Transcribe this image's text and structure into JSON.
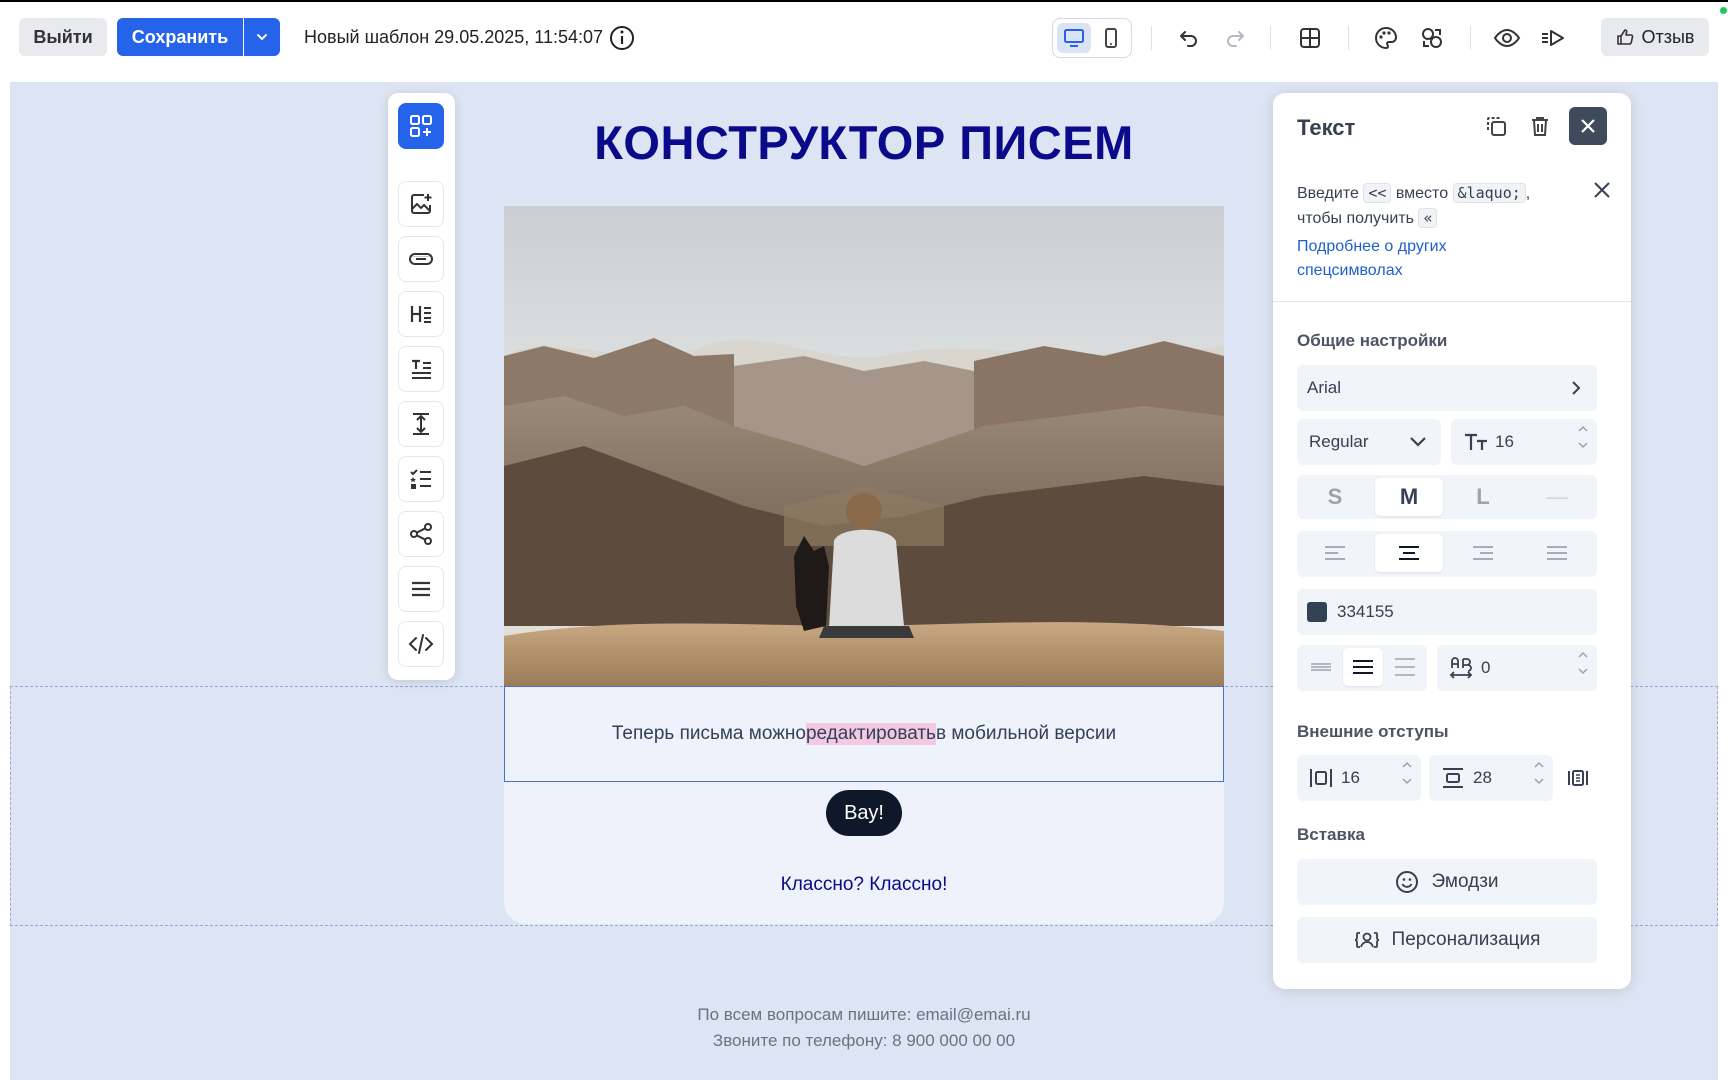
{
  "header": {
    "exit_label": "Выйти",
    "save_label": "Сохранить",
    "doc_title": "Новый шаблон 29.05.2025, 11:54:07",
    "feedback_label": "Отзыв"
  },
  "email": {
    "title": "КОНСТРУКТОР ПИСЕМ",
    "text_before": "Теперь письма можно ",
    "text_highlight": "редактировать",
    "text_after": " в мобильной версии",
    "button_label": "Вау!",
    "link_text": "Классно? Классно!",
    "footer_line1": "По всем вопросам пишите: email@emai.ru",
    "footer_line2": "Звоните по телефону: 8 900 000 00 00"
  },
  "panel": {
    "title": "Текст",
    "hint_pre": "Введите",
    "hint_code1": "<<",
    "hint_mid": "вместо",
    "hint_code2": "&laquo;",
    "hint_comma": ",",
    "hint_line2": "чтобы получить",
    "hint_code3": "«",
    "hint_link": "Подробнее о других спецсимволах",
    "general_label": "Общие настройки",
    "font_family": "Arial",
    "font_weight": "Regular",
    "font_size": "16",
    "size_s": "S",
    "size_m": "M",
    "size_l": "L",
    "size_none": "—",
    "color_hex": "334155",
    "color_swatch": "#334155",
    "letter_spacing": "0",
    "margins_label": "Внешние отступы",
    "margin_h": "16",
    "margin_v": "28",
    "insert_label": "Вставка",
    "emoji_label": "Эмодзи",
    "personalize_label": "Персонализация"
  },
  "colors": {
    "accent": "#2563eb",
    "title": "#0a0a8a",
    "text": "#334155"
  }
}
